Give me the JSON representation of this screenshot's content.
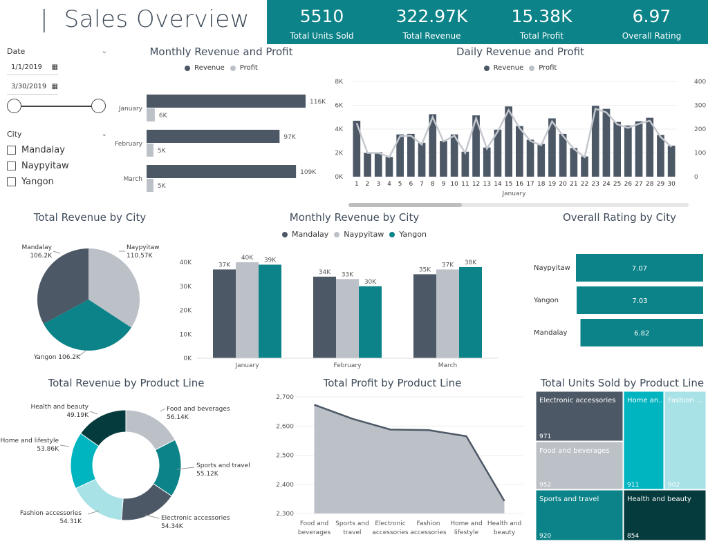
{
  "header": {
    "title": "Sales Overview"
  },
  "kpis": [
    {
      "value": "5510",
      "label": "Total Units Sold"
    },
    {
      "value": "322.97K",
      "label": "Total Revenue"
    },
    {
      "value": "15.38K",
      "label": "Total Profit"
    },
    {
      "value": "6.97",
      "label": "Overall Rating"
    }
  ],
  "filters": {
    "date": {
      "label": "Date",
      "start": "1/1/2019",
      "end": "3/30/2019"
    },
    "city": {
      "label": "City",
      "options": [
        "Mandalay",
        "Naypyitaw",
        "Yangon"
      ]
    }
  },
  "colors": {
    "dark": "#4d5866",
    "light": "#bcc1c8",
    "teal": "#0b8388",
    "kpi_band": "#0b8388"
  },
  "chart_data": [
    {
      "id": "monthly_rev_profit",
      "type": "bar",
      "title": "Monthly Revenue and Profit",
      "orientation": "horizontal",
      "categories": [
        "January",
        "February",
        "March"
      ],
      "series": [
        {
          "name": "Revenue",
          "values": [
            116,
            97,
            109
          ],
          "labels": [
            "116K",
            "97K",
            "109K"
          ]
        },
        {
          "name": "Profit",
          "values": [
            6,
            5,
            5
          ],
          "labels": [
            "6K",
            "5K",
            "5K"
          ]
        }
      ]
    },
    {
      "id": "daily_rev_profit",
      "type": "bar",
      "title": "Daily Revenue and Profit",
      "xlabel": "January",
      "x": [
        1,
        2,
        3,
        4,
        5,
        6,
        7,
        8,
        9,
        10,
        11,
        12,
        13,
        14,
        15,
        16,
        17,
        18,
        19,
        20,
        21,
        22,
        23,
        24,
        25,
        26,
        27,
        28,
        29,
        30
      ],
      "ylim": [
        0,
        8000
      ],
      "y_ticks": [
        "0K",
        "2K",
        "4K",
        "6K",
        "8K"
      ],
      "y2lim": [
        0,
        400
      ],
      "y2_ticks": [
        "0",
        "100",
        "200",
        "300",
        "400"
      ],
      "series": [
        {
          "name": "Revenue",
          "type": "bar",
          "values": [
            4700,
            2000,
            2050,
            1650,
            3550,
            3600,
            2850,
            5250,
            3000,
            3550,
            2100,
            5150,
            2450,
            3950,
            5900,
            4250,
            3100,
            2750,
            4900,
            3600,
            2400,
            1700,
            5950,
            5700,
            4600,
            4300,
            4650,
            4950,
            3500,
            2600
          ]
        },
        {
          "name": "Profit",
          "type": "line",
          "values": [
            225,
            100,
            100,
            82,
            170,
            172,
            135,
            250,
            148,
            172,
            100,
            245,
            118,
            190,
            280,
            205,
            150,
            132,
            232,
            172,
            117,
            82,
            285,
            270,
            220,
            205,
            222,
            235,
            167,
            125
          ]
        }
      ]
    },
    {
      "id": "rev_by_city",
      "type": "pie",
      "title": "Total Revenue by City",
      "slices": [
        {
          "name": "Naypyitaw",
          "value": 110.57,
          "label": "110.57K"
        },
        {
          "name": "Yangon",
          "value": 106.2,
          "label": "106.2K"
        },
        {
          "name": "Mandalay",
          "value": 106.2,
          "label": "106.2K"
        }
      ]
    },
    {
      "id": "monthly_rev_city",
      "type": "bar",
      "title": "Monthly Revenue by City",
      "categories": [
        "January",
        "February",
        "March"
      ],
      "ylim": [
        0,
        40000
      ],
      "y_ticks": [
        "0K",
        "10K",
        "20K",
        "30K",
        "40K"
      ],
      "series": [
        {
          "name": "Mandalay",
          "values": [
            37,
            34,
            35
          ],
          "labels": [
            "37K",
            "34K",
            "35K"
          ]
        },
        {
          "name": "Naypyitaw",
          "values": [
            40,
            33,
            37
          ],
          "labels": [
            "40K",
            "33K",
            "37K"
          ]
        },
        {
          "name": "Yangon",
          "values": [
            39,
            30,
            38
          ],
          "labels": [
            "39K",
            "30K",
            "38K"
          ]
        }
      ]
    },
    {
      "id": "rating_by_city",
      "type": "bar",
      "title": "Overall Rating by City",
      "orientation": "horizontal",
      "categories": [
        "Naypyitaw",
        "Yangon",
        "Mandalay"
      ],
      "values": [
        7.07,
        7.03,
        6.82
      ],
      "labels": [
        "7.07",
        "7.03",
        "6.82"
      ]
    },
    {
      "id": "rev_by_product",
      "type": "pie",
      "donut": true,
      "title": "Total Revenue by Product Line",
      "slices": [
        {
          "name": "Food and beverages",
          "value": 56.14,
          "label": "56.14K"
        },
        {
          "name": "Sports and travel",
          "value": 55.12,
          "label": "55.12K"
        },
        {
          "name": "Electronic accessories",
          "value": 54.34,
          "label": "54.34K"
        },
        {
          "name": "Fashion accessories",
          "value": 54.31,
          "label": "54.31K"
        },
        {
          "name": "Home and lifestyle",
          "value": 53.86,
          "label": "53.86K"
        },
        {
          "name": "Health and beauty",
          "value": 49.19,
          "label": "49.19K"
        }
      ]
    },
    {
      "id": "profit_by_product",
      "type": "area",
      "title": "Total Profit by Product Line",
      "categories": [
        "Food and beverages",
        "Sports and travel",
        "Electronic accessories",
        "Fashion accessories",
        "Home and lifestyle",
        "Health and beauty"
      ],
      "ylim": [
        2300,
        2700
      ],
      "y_ticks": [
        "2,300",
        "2,400",
        "2,500",
        "2,600",
        "2,700"
      ],
      "values": [
        2673,
        2625,
        2588,
        2586,
        2565,
        2343
      ]
    },
    {
      "id": "units_by_product",
      "type": "treemap",
      "title": "Total Units Sold by Product Line",
      "items": [
        {
          "name": "Electronic accessories",
          "value": 971
        },
        {
          "name": "Food and beverages",
          "value": 952
        },
        {
          "name": "Sports and travel",
          "value": 920
        },
        {
          "name": "Home and lifestyle",
          "label": "Home an...",
          "value": 911
        },
        {
          "name": "Fashion accessories",
          "label": "Fashion ...",
          "value": 902
        },
        {
          "name": "Health and beauty",
          "value": 854
        }
      ]
    }
  ]
}
